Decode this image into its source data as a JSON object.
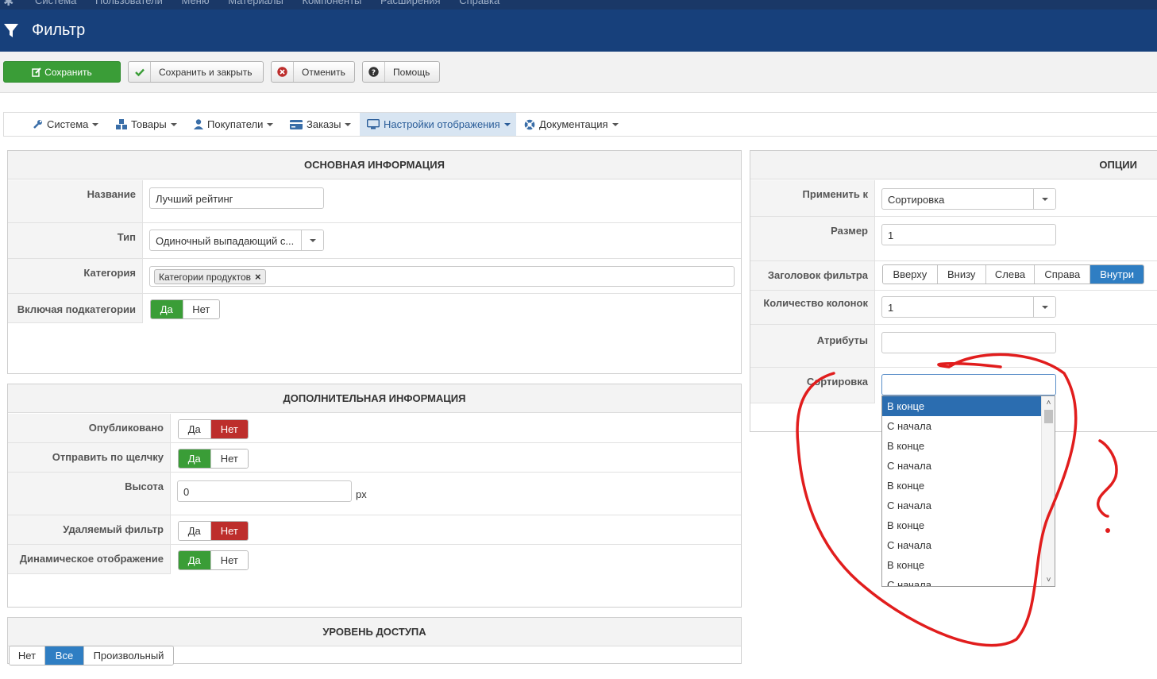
{
  "topbar": {
    "menu": [
      "Система",
      "Пользователи",
      "Меню",
      "Материалы",
      "Компоненты",
      "Расширения",
      "Справка"
    ]
  },
  "header": {
    "title": "Фильтр"
  },
  "toolbar": {
    "save": "Сохранить",
    "save_close": "Сохранить и закрыть",
    "cancel": "Отменить",
    "help": "Помощь"
  },
  "nav": {
    "system": "Система",
    "goods": "Товары",
    "buyers": "Покупатели",
    "orders": "Заказы",
    "display": "Настройки отображения",
    "docs": "Документация"
  },
  "main": {
    "title": "ОСНОВНАЯ ИНФОРМАЦИЯ",
    "name_label": "Название",
    "name_value": "Лучший рейтинг",
    "type_label": "Тип",
    "type_value": "Одиночный выпадающий с...",
    "category_label": "Категория",
    "category_chip": "Категории продуктов",
    "subcats_label": "Включая подкатегории",
    "yes": "Да",
    "no": "Нет"
  },
  "extra": {
    "title": "ДОПОЛНИТЕЛЬНАЯ ИНФОРМАЦИЯ",
    "published": "Опубликовано",
    "send_click": "Отправить по щелчку",
    "height": "Высота",
    "height_value": "0",
    "height_unit": "px",
    "removable": "Удаляемый фильтр",
    "dynamic": "Динамическое отображение"
  },
  "access": {
    "title": "УРОВЕНЬ ДОСТУПА",
    "none": "Нет",
    "all": "Все",
    "custom": "Произвольный"
  },
  "options": {
    "title": "ОПЦИИ",
    "apply_label": "Применить к",
    "apply_value": "Сортировка",
    "size_label": "Размер",
    "size_value": "1",
    "header_label": "Заголовок фильтра",
    "pos_top": "Вверху",
    "pos_bottom": "Внизу",
    "pos_left": "Слева",
    "pos_right": "Справа",
    "pos_inside": "Внутри",
    "cols_label": "Количество колонок",
    "cols_value": "1",
    "attrs_label": "Атрибуты",
    "sort_label": "Сортировка"
  },
  "sort_options": [
    "В конце",
    "С начала",
    "В конце",
    "С начала",
    "В конце",
    "С начала",
    "В конце",
    "С начала",
    "В конце",
    "С начала"
  ],
  "colors": {
    "header": "#17407b",
    "green": "#3a9d37",
    "red": "#bd2e2c",
    "blue": "#2f7ec3",
    "annotation": "#e11d1d"
  }
}
